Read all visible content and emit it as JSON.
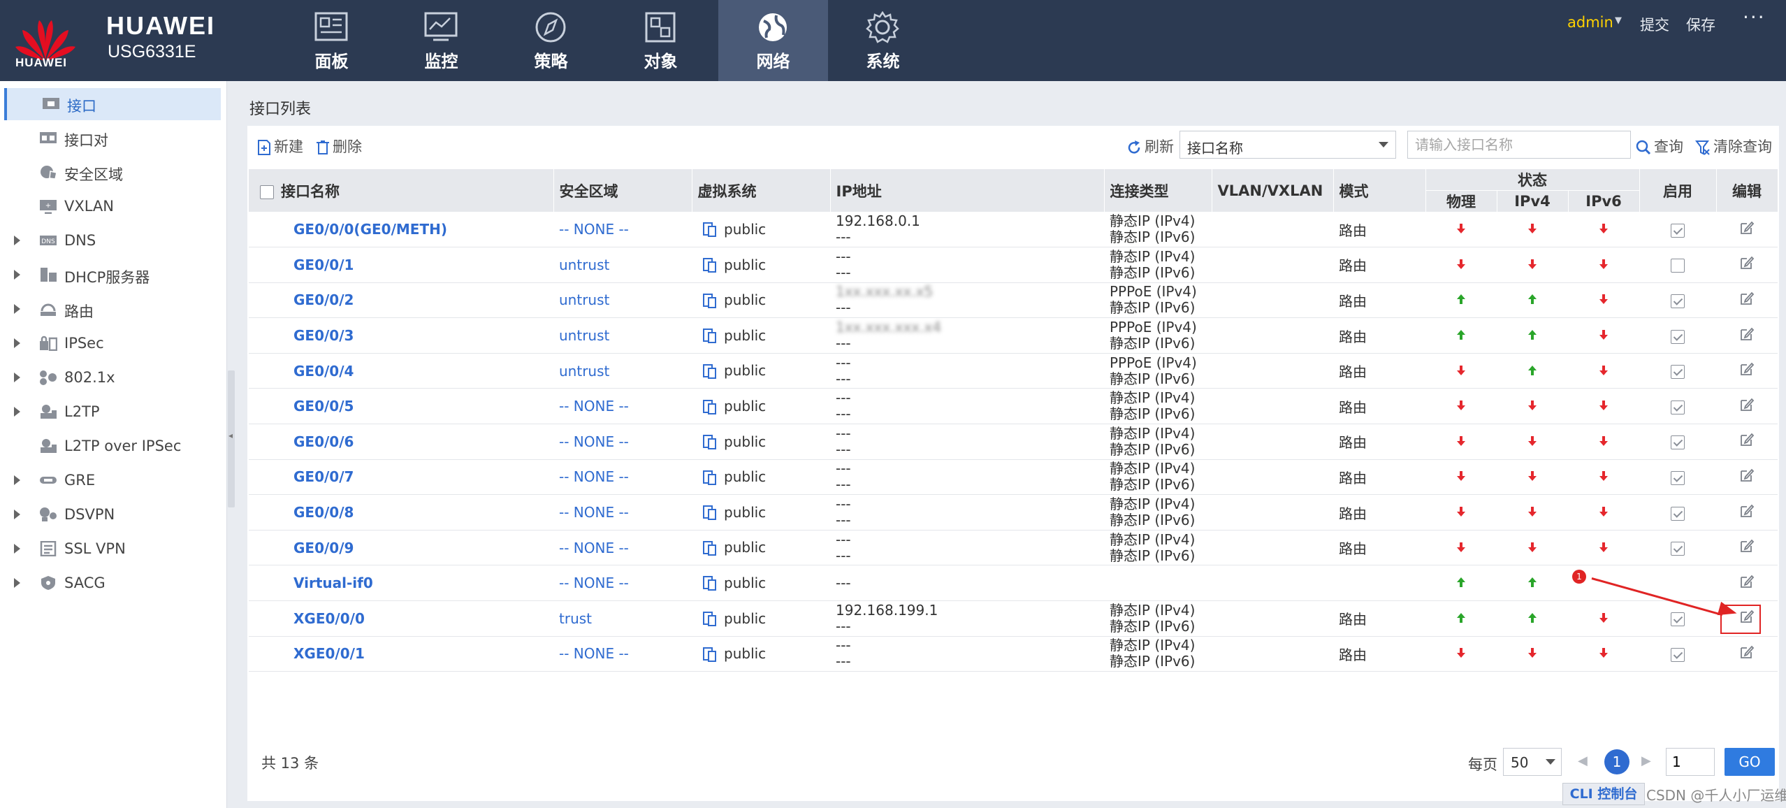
{
  "brand": {
    "logo_word": "HUAWEI",
    "name": "HUAWEI",
    "model": "USG6331E",
    "logo_color": "#e40e21"
  },
  "nav": [
    {
      "label": "面板",
      "icon": "dashboard-icon"
    },
    {
      "label": "监控",
      "icon": "monitor-icon"
    },
    {
      "label": "策略",
      "icon": "policy-compass-icon"
    },
    {
      "label": "对象",
      "icon": "object-icon"
    },
    {
      "label": "网络",
      "icon": "network-globe-icon",
      "active": true
    },
    {
      "label": "系统",
      "icon": "gear-icon"
    }
  ],
  "topright": {
    "user": "admin",
    "commit": "提交",
    "save": "保存",
    "more": "···"
  },
  "sidebar": [
    {
      "label": "接口",
      "icon": "interface-icon",
      "active": true,
      "expandable": false
    },
    {
      "label": "接口对",
      "icon": "interface-pair-icon",
      "expandable": false
    },
    {
      "label": "安全区域",
      "icon": "security-zone-icon",
      "expandable": false
    },
    {
      "label": "VXLAN",
      "icon": "vxlan-icon",
      "expandable": false
    },
    {
      "label": "DNS",
      "icon": "dns-icon",
      "expandable": true
    },
    {
      "label": "DHCP服务器",
      "icon": "dhcp-server-icon",
      "expandable": true
    },
    {
      "label": "路由",
      "icon": "route-icon",
      "expandable": true
    },
    {
      "label": "IPSec",
      "icon": "ipsec-icon",
      "expandable": true
    },
    {
      "label": "802.1x",
      "icon": "dot1x-icon",
      "expandable": true
    },
    {
      "label": "L2TP",
      "icon": "l2tp-icon",
      "expandable": true
    },
    {
      "label": "L2TP over IPSec",
      "icon": "l2tp-ipsec-icon",
      "expandable": false
    },
    {
      "label": "GRE",
      "icon": "gre-icon",
      "expandable": true
    },
    {
      "label": "DSVPN",
      "icon": "dsvpn-icon",
      "expandable": true
    },
    {
      "label": "SSL VPN",
      "icon": "ssl-vpn-icon",
      "expandable": true
    },
    {
      "label": "SACG",
      "icon": "sacg-icon",
      "expandable": true
    }
  ],
  "page": {
    "title": "接口列表"
  },
  "toolbar": {
    "new_label": "新建",
    "delete_label": "删除",
    "refresh_label": "刷新",
    "search_field": "接口名称",
    "search_placeholder": "请输入接口名称",
    "query_label": "查询",
    "clear_label": "清除查询"
  },
  "columns": {
    "name": "接口名称",
    "zone": "安全区域",
    "vsys": "虚拟系统",
    "ip": "IP地址",
    "conn_type": "连接类型",
    "vlan": "VLAN/VXLAN",
    "mode": "模式",
    "status": "状态",
    "physical": "物理",
    "ipv4": "IPv4",
    "ipv6": "IPv6",
    "enable": "启用",
    "edit": "编辑"
  },
  "rows": [
    {
      "name": "GE0/0/0(GE0/METH)",
      "zone": "-- NONE --",
      "vsys": "public",
      "ip1": "192.168.0.1",
      "ip2": "---",
      "conn1": "静态IP (IPv4)",
      "conn2": "静态IP (IPv6)",
      "mode": "路由",
      "phys": "down",
      "v4": "down",
      "v6": "down",
      "enabled": true
    },
    {
      "name": "GE0/0/1",
      "zone": "untrust",
      "vsys": "public",
      "ip1": "---",
      "ip2": "---",
      "conn1": "静态IP (IPv4)",
      "conn2": "静态IP (IPv6)",
      "mode": "路由",
      "phys": "down",
      "v4": "down",
      "v6": "down",
      "enabled": false
    },
    {
      "name": "GE0/0/2",
      "zone": "untrust",
      "vsys": "public",
      "ip1": "1xx.xxx.xx.x5",
      "ip2": "---",
      "ip_blurred": true,
      "conn1": "PPPoE (IPv4)",
      "conn2": "静态IP (IPv6)",
      "mode": "路由",
      "phys": "up",
      "v4": "up",
      "v6": "down",
      "enabled": true
    },
    {
      "name": "GE0/0/3",
      "zone": "untrust",
      "vsys": "public",
      "ip1": "1xx.xxx.xxx.x4",
      "ip2": "---",
      "ip_blurred": true,
      "conn1": "PPPoE (IPv4)",
      "conn2": "静态IP (IPv6)",
      "mode": "路由",
      "phys": "up",
      "v4": "up",
      "v6": "down",
      "enabled": true
    },
    {
      "name": "GE0/0/4",
      "zone": "untrust",
      "vsys": "public",
      "ip1": "---",
      "ip2": "---",
      "conn1": "PPPoE (IPv4)",
      "conn2": "静态IP (IPv6)",
      "mode": "路由",
      "phys": "down",
      "v4": "up",
      "v6": "down",
      "enabled": true
    },
    {
      "name": "GE0/0/5",
      "zone": "-- NONE --",
      "vsys": "public",
      "ip1": "---",
      "ip2": "---",
      "conn1": "静态IP (IPv4)",
      "conn2": "静态IP (IPv6)",
      "mode": "路由",
      "phys": "down",
      "v4": "down",
      "v6": "down",
      "enabled": true
    },
    {
      "name": "GE0/0/6",
      "zone": "-- NONE --",
      "vsys": "public",
      "ip1": "---",
      "ip2": "---",
      "conn1": "静态IP (IPv4)",
      "conn2": "静态IP (IPv6)",
      "mode": "路由",
      "phys": "down",
      "v4": "down",
      "v6": "down",
      "enabled": true
    },
    {
      "name": "GE0/0/7",
      "zone": "-- NONE --",
      "vsys": "public",
      "ip1": "---",
      "ip2": "---",
      "conn1": "静态IP (IPv4)",
      "conn2": "静态IP (IPv6)",
      "mode": "路由",
      "phys": "down",
      "v4": "down",
      "v6": "down",
      "enabled": true
    },
    {
      "name": "GE0/0/8",
      "zone": "-- NONE --",
      "vsys": "public",
      "ip1": "---",
      "ip2": "---",
      "conn1": "静态IP (IPv4)",
      "conn2": "静态IP (IPv6)",
      "mode": "路由",
      "phys": "down",
      "v4": "down",
      "v6": "down",
      "enabled": true
    },
    {
      "name": "GE0/0/9",
      "zone": "-- NONE --",
      "vsys": "public",
      "ip1": "---",
      "ip2": "---",
      "conn1": "静态IP (IPv4)",
      "conn2": "静态IP (IPv6)",
      "mode": "路由",
      "phys": "down",
      "v4": "down",
      "v6": "down",
      "enabled": true
    },
    {
      "name": "Virtual-if0",
      "zone": "-- NONE --",
      "vsys": "public",
      "ip1": "---",
      "ip2": "",
      "conn1": "",
      "conn2": "",
      "mode": "",
      "phys": "up",
      "v4": "up",
      "v6": "",
      "enabled": null
    },
    {
      "name": "XGE0/0/0",
      "zone": "trust",
      "vsys": "public",
      "ip1": "192.168.199.1",
      "ip2": "---",
      "conn1": "静态IP (IPv4)",
      "conn2": "静态IP (IPv6)",
      "mode": "路由",
      "phys": "up",
      "v4": "up",
      "v6": "down",
      "enabled": true,
      "highlight_edit": true
    },
    {
      "name": "XGE0/0/1",
      "zone": "-- NONE --",
      "vsys": "public",
      "ip1": "---",
      "ip2": "---",
      "conn1": "静态IP (IPv4)",
      "conn2": "静态IP (IPv6)",
      "mode": "路由",
      "phys": "down",
      "v4": "down",
      "v6": "down",
      "enabled": true
    }
  ],
  "footer": {
    "total": "共 13 条",
    "per_page_label": "每页",
    "per_page": "50",
    "current_page": "1",
    "page_input": "1",
    "go_label": "GO"
  },
  "annotation": {
    "badge": "1",
    "color": "#e02424"
  },
  "status_colors": {
    "up": "#2aa52a",
    "down": "#e5272d"
  },
  "bottom": {
    "cli_label": "CLI 控制台",
    "watermark": "CSDN @千人小厂运维主管"
  }
}
